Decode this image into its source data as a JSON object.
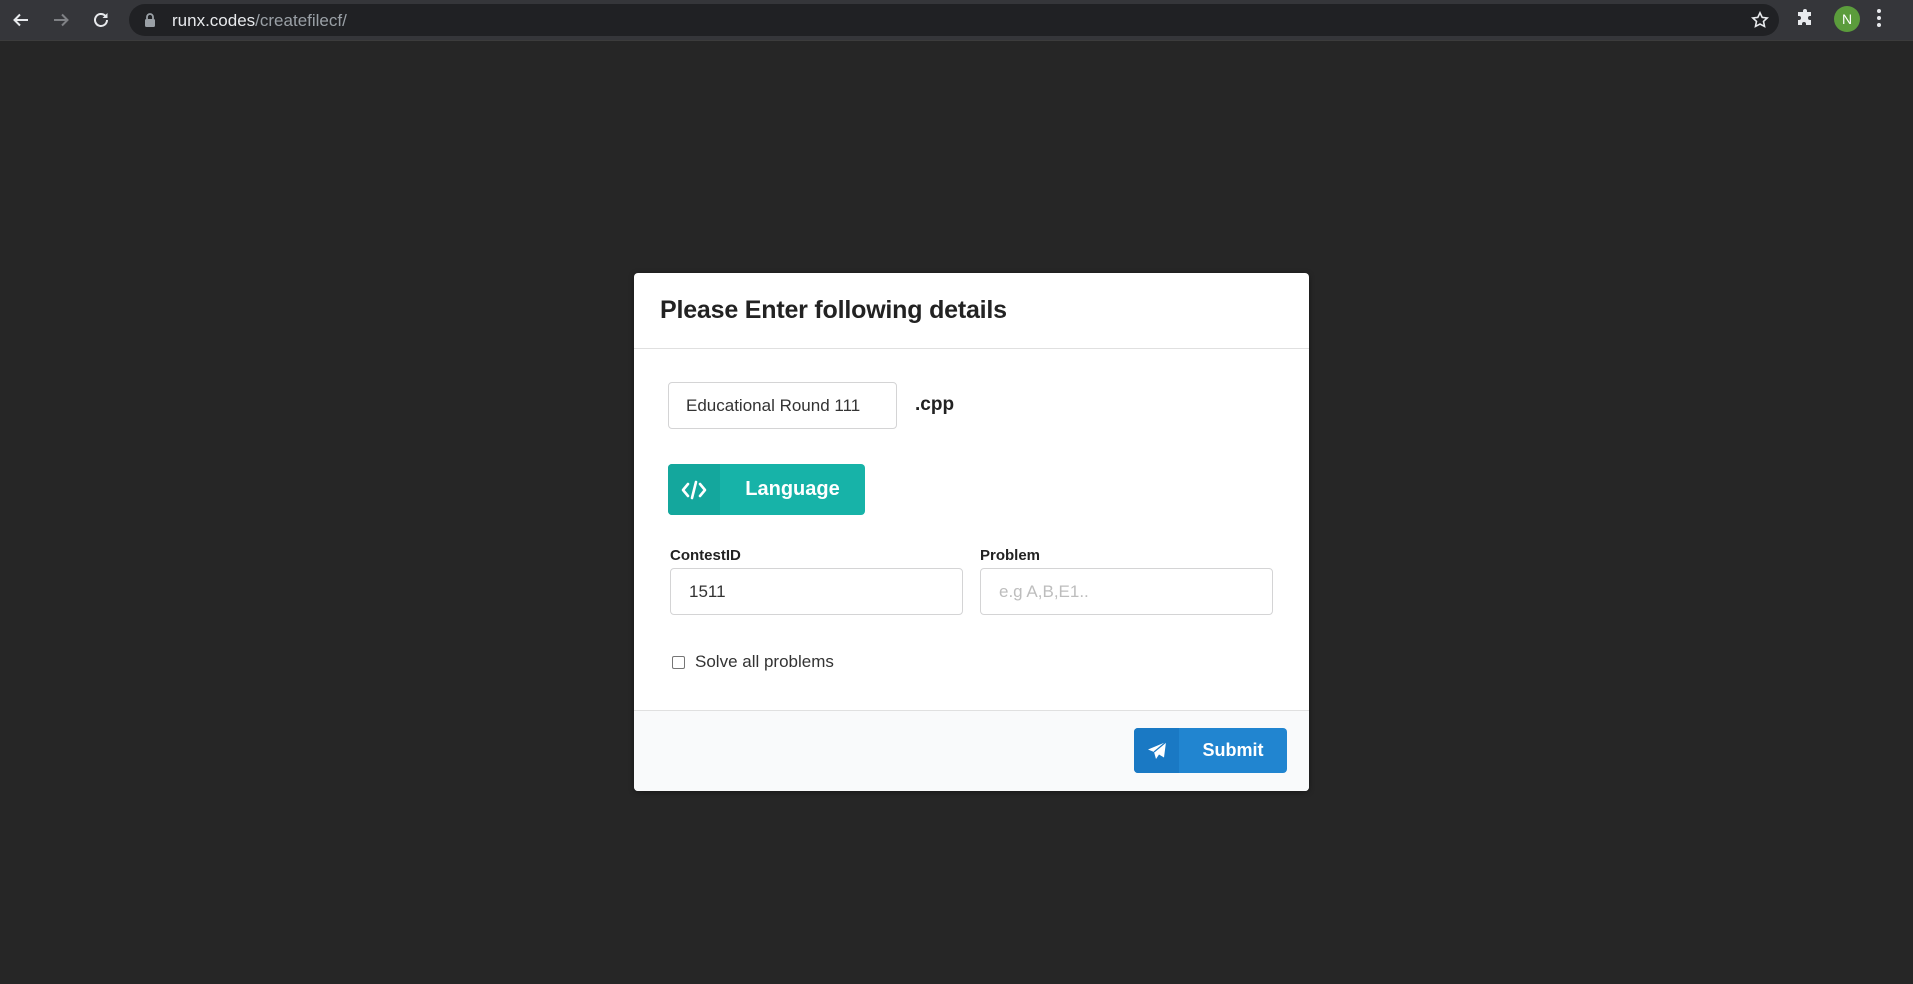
{
  "browser": {
    "url_host": "runx.codes",
    "url_path": "/createfilecf/",
    "avatar_initial": "N"
  },
  "modal": {
    "title": "Please Enter following details",
    "file_name_value": "Educational Round 111",
    "file_extension": ".cpp",
    "language_button_label": "Language",
    "contest_id_label": "ContestID",
    "contest_id_value": "1511",
    "problem_label": "Problem",
    "problem_placeholder": "e.g A,B,E1..",
    "solve_all_label": "Solve all problems",
    "solve_all_checked": false,
    "submit_label": "Submit"
  },
  "colors": {
    "page_background": "#262626",
    "language_button": "#17b3a8",
    "submit_button": "#2185d0"
  },
  "icons": {
    "back": "arrow-left-icon",
    "forward": "arrow-right-icon",
    "reload": "reload-icon",
    "lock": "lock-icon",
    "bookmark": "star-icon",
    "extensions": "puzzle-icon",
    "menu": "more-vert-icon",
    "language": "code-icon",
    "submit": "paper-plane-icon"
  }
}
